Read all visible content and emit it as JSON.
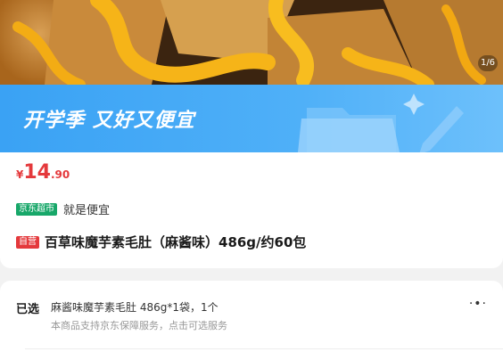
{
  "gallery": {
    "indicator": "1/6"
  },
  "promo": {
    "title": "开学季 又好又便宜"
  },
  "price": {
    "currency": "¥",
    "integer": "14",
    "decimal": ".90"
  },
  "tagline": {
    "badge": "京东超市",
    "text": "就是便宜"
  },
  "product": {
    "badge": "自营",
    "title": "百草味魔芋素毛肚（麻酱味）486g/约60包"
  },
  "selection": {
    "label": "已选",
    "value": "麻酱味魔芋素毛肚 486g*1袋，1个",
    "service": "本商品支持京东保障服务，点击可选服务"
  },
  "colors": {
    "price": "#e4393c",
    "promo_bg": "#3aa2f4",
    "mart_badge": "#17a769",
    "self_badge": "#e4393c"
  }
}
